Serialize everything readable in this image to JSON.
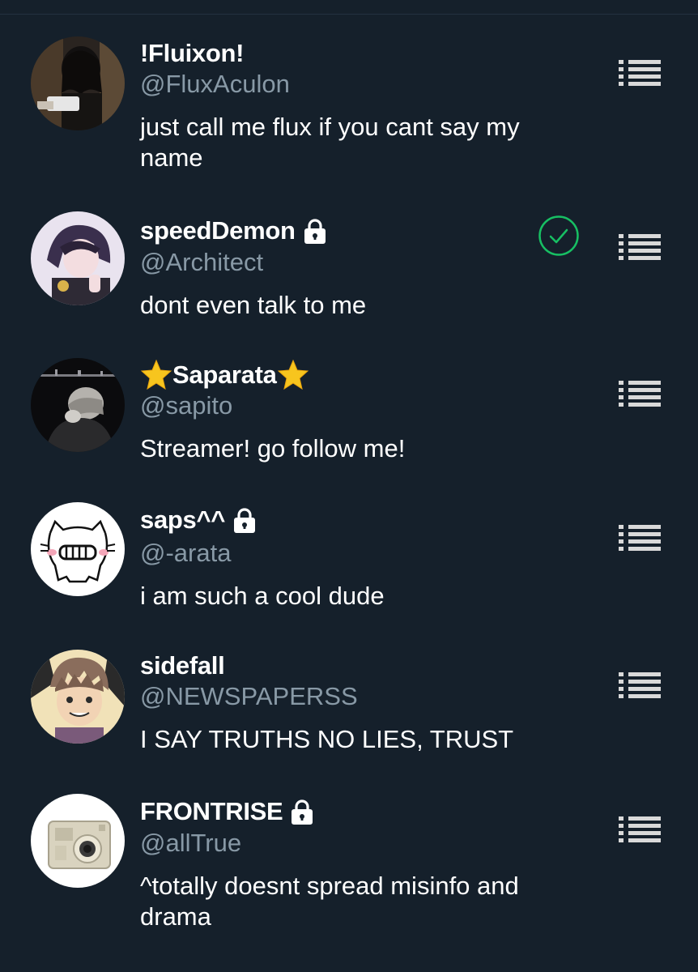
{
  "users": [
    {
      "display_name": "!Fluixon!",
      "handle": "@FluxAculon",
      "bio": "just call me flux if you cant say my name",
      "protected": false,
      "followed": false,
      "avatar_icon": "avatar-dark-hair-photo"
    },
    {
      "display_name": "speedDemon",
      "handle": "@Architect",
      "bio": "dont even talk to me",
      "protected": true,
      "followed": true,
      "avatar_icon": "avatar-anime-purple-hair"
    },
    {
      "display_name": "Saparata",
      "name_prefix_emoji": "star-icon",
      "name_suffix_emoji": "star-icon",
      "handle": "@sapito",
      "bio": "Streamer! go follow me!",
      "protected": false,
      "followed": false,
      "avatar_icon": "avatar-night-city-photo"
    },
    {
      "display_name": "saps^^",
      "handle": "@-arata",
      "bio": "i am such a cool dude",
      "protected": true,
      "followed": false,
      "avatar_icon": "avatar-cat-doodle"
    },
    {
      "display_name": "sidefall",
      "handle": "@NEWSPAPERSS",
      "bio": "I SAY TRUTHS NO LIES, TRUST",
      "protected": false,
      "followed": false,
      "avatar_icon": "avatar-anime-brown-hair"
    },
    {
      "display_name": "FRONTRISE",
      "handle": "@allTrue",
      "bio": "^totally doesnt spread misinfo and drama",
      "protected": true,
      "followed": false,
      "avatar_icon": "avatar-pixel-camera"
    }
  ],
  "colors": {
    "background": "#15202b",
    "name": "#ffffff",
    "handle": "#8899a6",
    "followed_check": "#17bf63",
    "menu_icon": "#d9d9d9"
  }
}
